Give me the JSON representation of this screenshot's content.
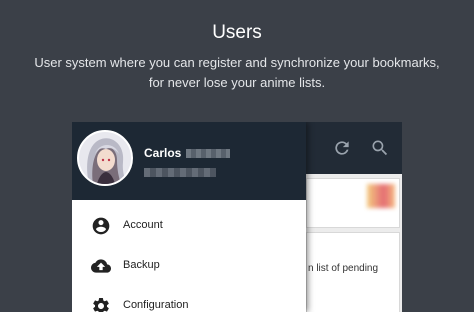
{
  "hero": {
    "title": "Users",
    "subtitle": "User system where you can register and synchronize your bookmarks, for never lose your anime lists."
  },
  "app": {
    "toolbar": {
      "icons": [
        "refresh-icon",
        "search-icon"
      ]
    },
    "content": {
      "partial_text": "n list of pending"
    }
  },
  "drawer": {
    "user_name": "Carlos",
    "menu": [
      {
        "label": "Account",
        "icon": "account-circle-icon"
      },
      {
        "label": "Backup",
        "icon": "cloud-upload-icon"
      },
      {
        "label": "Configuration",
        "icon": "gear-icon"
      }
    ]
  },
  "colors": {
    "page_background": "#3b4048",
    "drawer_header": "#1d2834",
    "app_bar": "#222b36",
    "drawer_background": "#ffffff"
  }
}
